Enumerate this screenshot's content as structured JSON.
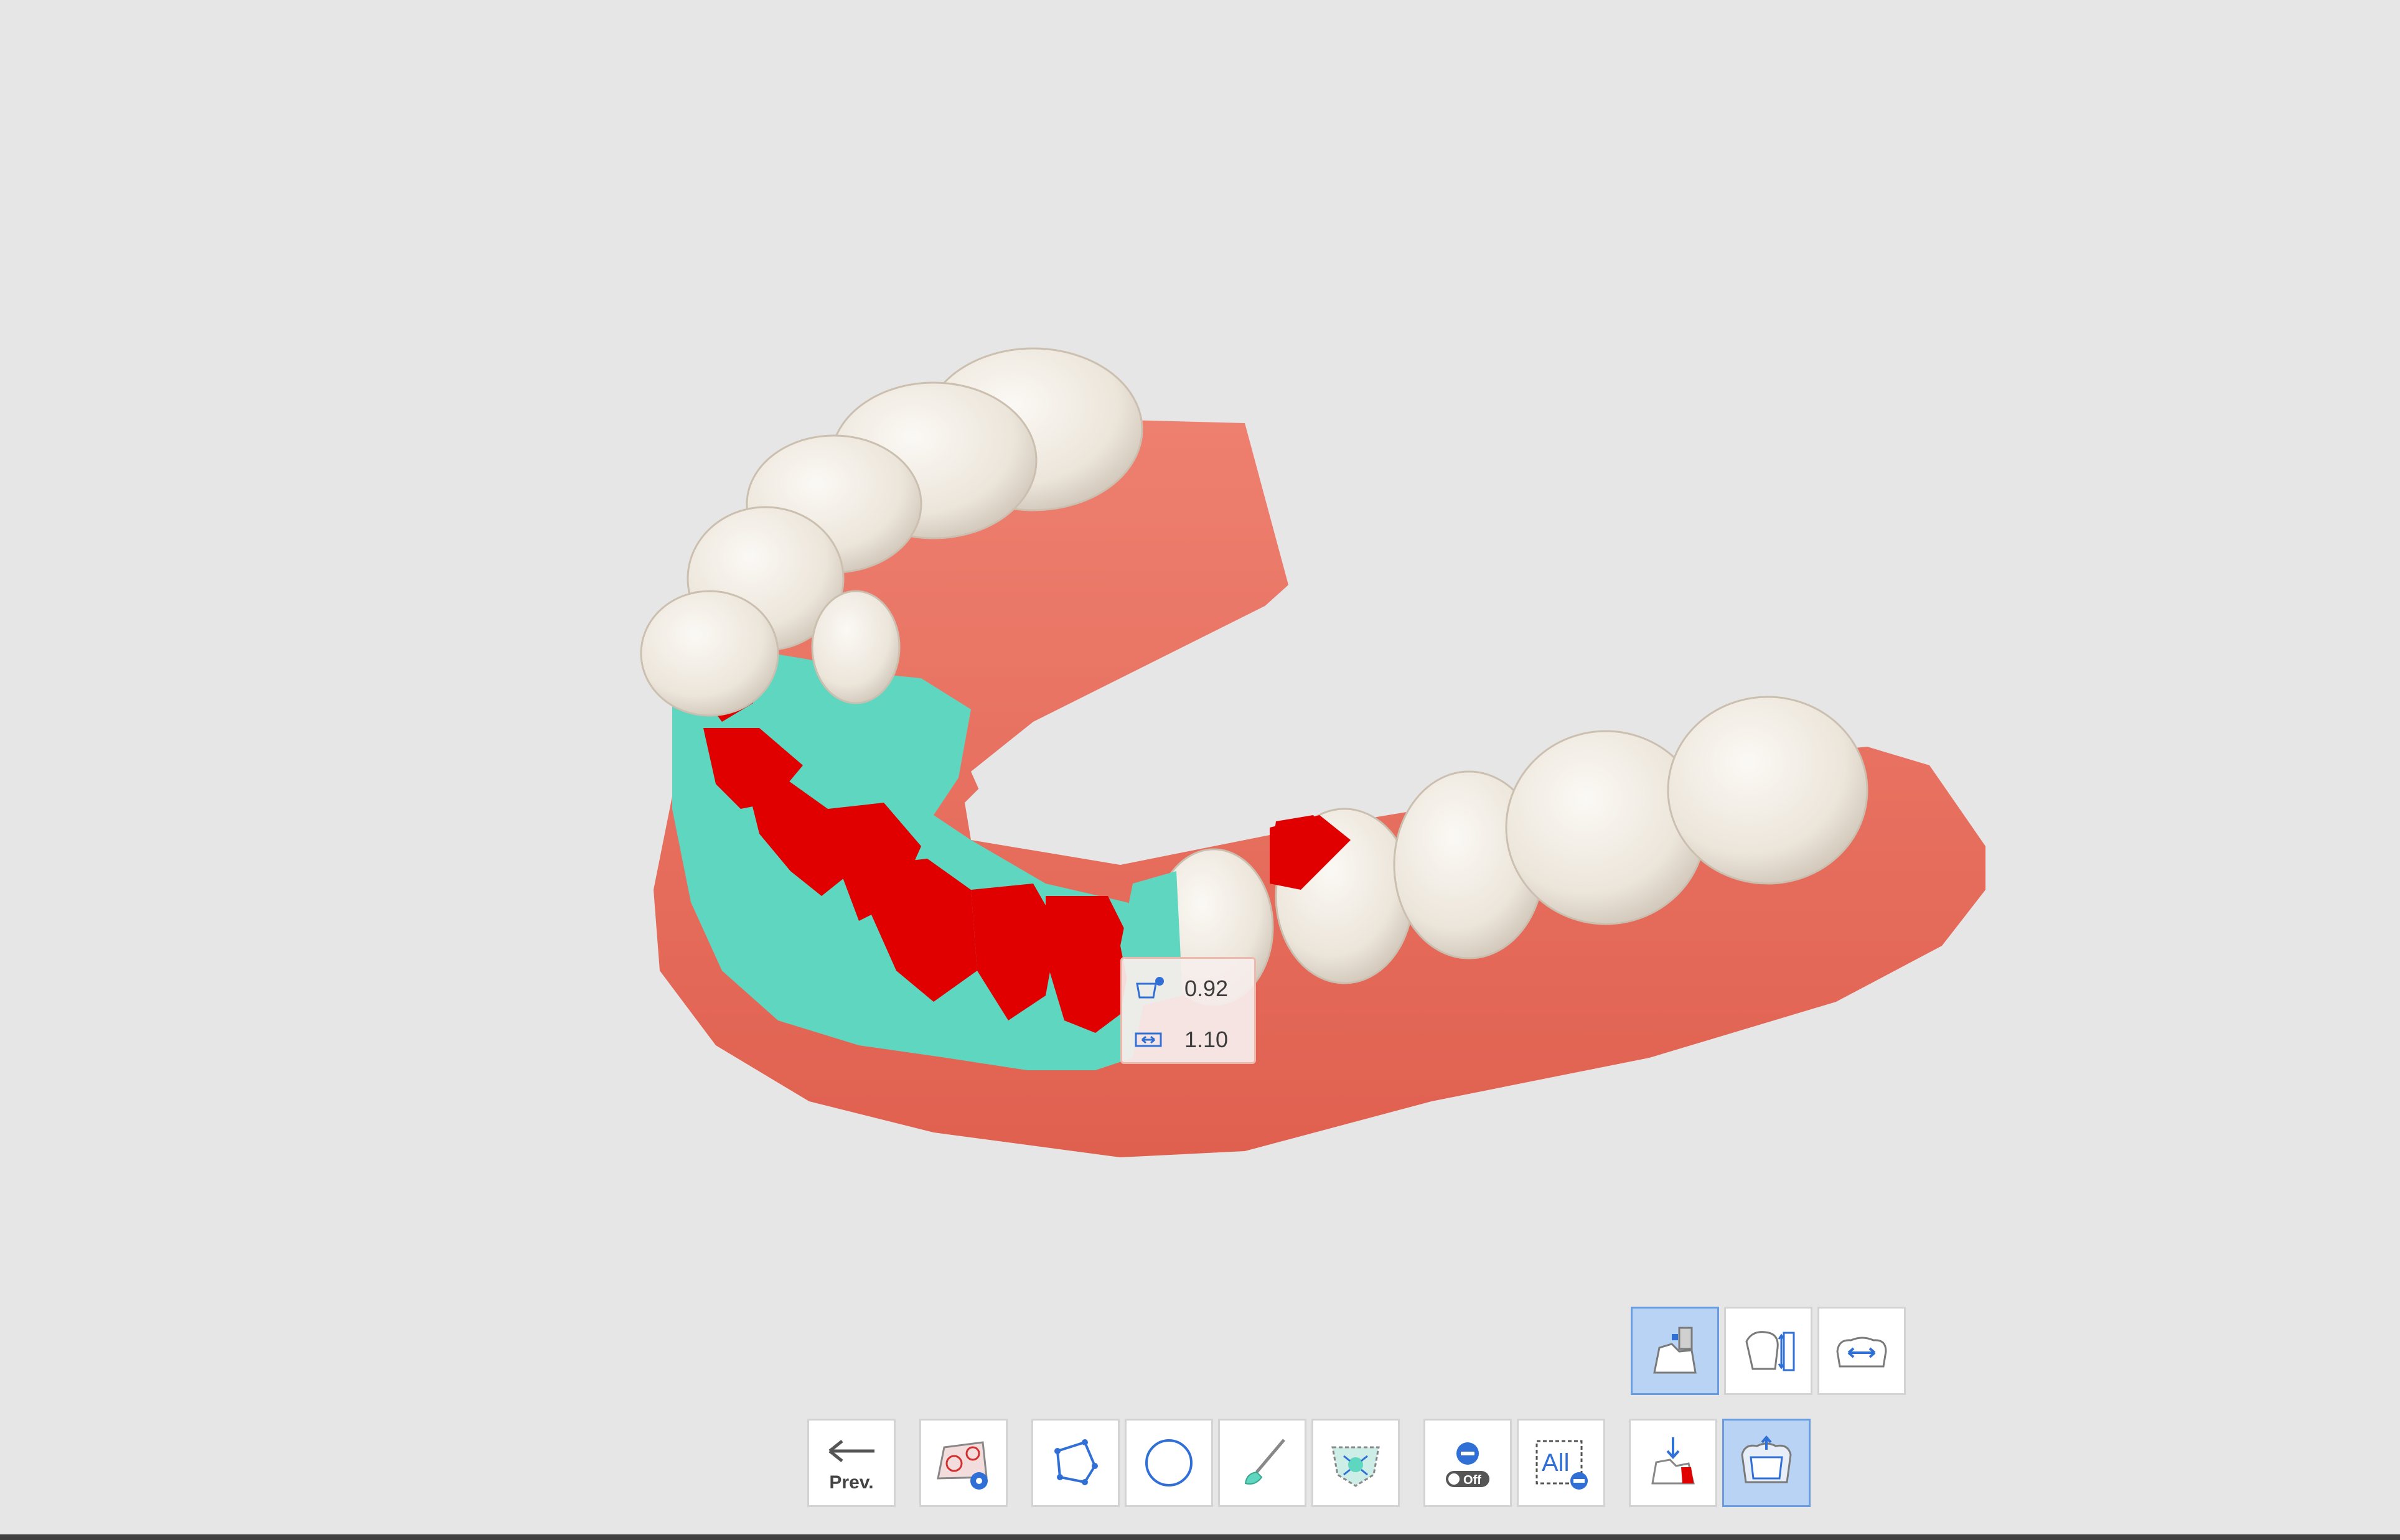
{
  "tooltip": {
    "thickness_icon": "cement-thickness-icon",
    "thickness_value": "0.92",
    "offset_icon": "gap-offset-icon",
    "offset_value": "1.10"
  },
  "toolbar": {
    "prev_label": "Prev.",
    "buttons": [
      {
        "name": "prev-button",
        "icon": "arrow-left-icon",
        "label": "Prev."
      },
      {
        "name": "margin-settings-button",
        "icon": "margin-settings-icon"
      },
      {
        "name": "polyline-select-button",
        "icon": "polygon-icon"
      },
      {
        "name": "circle-select-button",
        "icon": "circle-icon"
      },
      {
        "name": "brush-select-button",
        "icon": "brush-icon"
      },
      {
        "name": "auto-area-button",
        "icon": "auto-area-icon"
      },
      {
        "name": "deselect-toggle-button",
        "icon": "deselect-off-icon",
        "toggle_label": "Off"
      },
      {
        "name": "select-all-button",
        "icon": "select-all-icon",
        "label": "All"
      },
      {
        "name": "insertion-direction-button",
        "icon": "insertion-direction-icon"
      },
      {
        "name": "gap-view-button",
        "icon": "gap-view-icon",
        "active": true
      }
    ],
    "sub_buttons": [
      {
        "name": "cement-gap-button",
        "icon": "cement-gap-icon",
        "active": true
      },
      {
        "name": "height-measure-button",
        "icon": "height-measure-icon"
      },
      {
        "name": "width-adjust-button",
        "icon": "width-adjust-icon"
      }
    ]
  },
  "colors": {
    "background": "#e6e6e6",
    "gum": "#e8705f",
    "tooth": "#eee8df",
    "mint_overlay": "#5fd7c0",
    "red_overlay": "#e00000",
    "active_button": "#b9d3f4",
    "icon_blue": "#2f6fd6"
  }
}
